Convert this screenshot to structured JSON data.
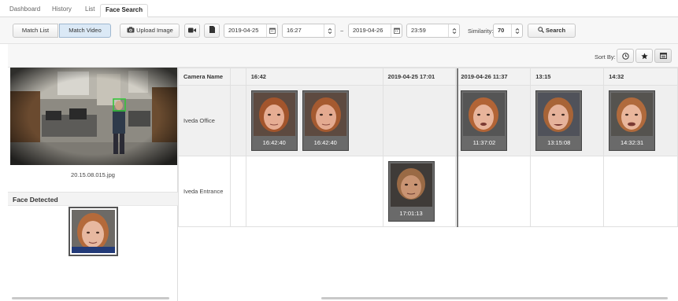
{
  "tabs": [
    "Dashboard",
    "History",
    "List",
    "Face Search"
  ],
  "toolbar": {
    "match_list": "Match List",
    "match_video": "Match Video",
    "upload_image": "Upload Image",
    "start_date": "2019-04-25",
    "start_time": "16:27",
    "range_sep": "~",
    "end_date": "2019-04-26",
    "end_time": "23:59",
    "similarity_label": "Similarity:",
    "similarity_value": "70",
    "search": "Search"
  },
  "left": {
    "filename": "20.15.08.015.jpg",
    "face_detected": "Face Detected"
  },
  "sort": {
    "label": "Sort By:",
    "icons": [
      "clock-icon",
      "star-icon",
      "grid-icon"
    ]
  },
  "grid": {
    "headers": [
      "Camera Name",
      "",
      "16:42",
      "2019-04-25  17:01",
      "2019-04-26  11:37",
      "13:15",
      "14:32"
    ],
    "rows": [
      {
        "camera": "Iveda Office",
        "cells": [
          [],
          [
            "16:42:40",
            "16:42:40"
          ],
          [],
          [
            "11:37:02"
          ],
          [
            "13:15:08"
          ],
          [
            "14:32:31"
          ]
        ]
      },
      {
        "camera": "Iveda Entrance",
        "cells": [
          [],
          [],
          [
            "17:01:13"
          ],
          [],
          [],
          []
        ]
      }
    ]
  },
  "colors": {
    "accent_green_box": "#36c43a",
    "segment_active": "#dbe9f6"
  }
}
